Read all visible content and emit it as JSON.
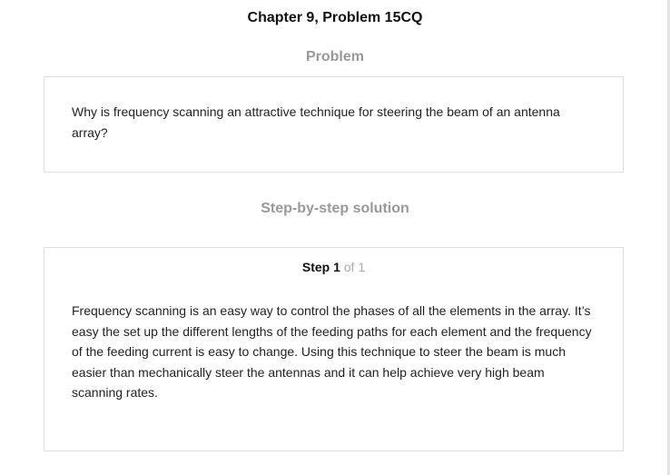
{
  "document": {
    "chapter_title": "Chapter 9, Problem 15CQ"
  },
  "problem": {
    "heading": "Problem",
    "text": "Why is frequency scanning an attractive technique for steering the beam of an antenna array?"
  },
  "solution": {
    "heading": "Step-by-step solution",
    "step": {
      "label": "Step 1",
      "of_text": "of 1",
      "text": "Frequency scanning is an easy way to control the phases of all the elements in the array. It’s easy the set up the different lengths of the feeding paths for each element and the frequency of the feeding current is easy to change. Using this technique to steer the beam is much easier than mechanically steer the antennas and it can help achieve very high beam scanning rates."
    }
  },
  "colors": {
    "heading_gray": "#999999",
    "border_gray": "#dddddd",
    "text_dark": "#222222"
  }
}
